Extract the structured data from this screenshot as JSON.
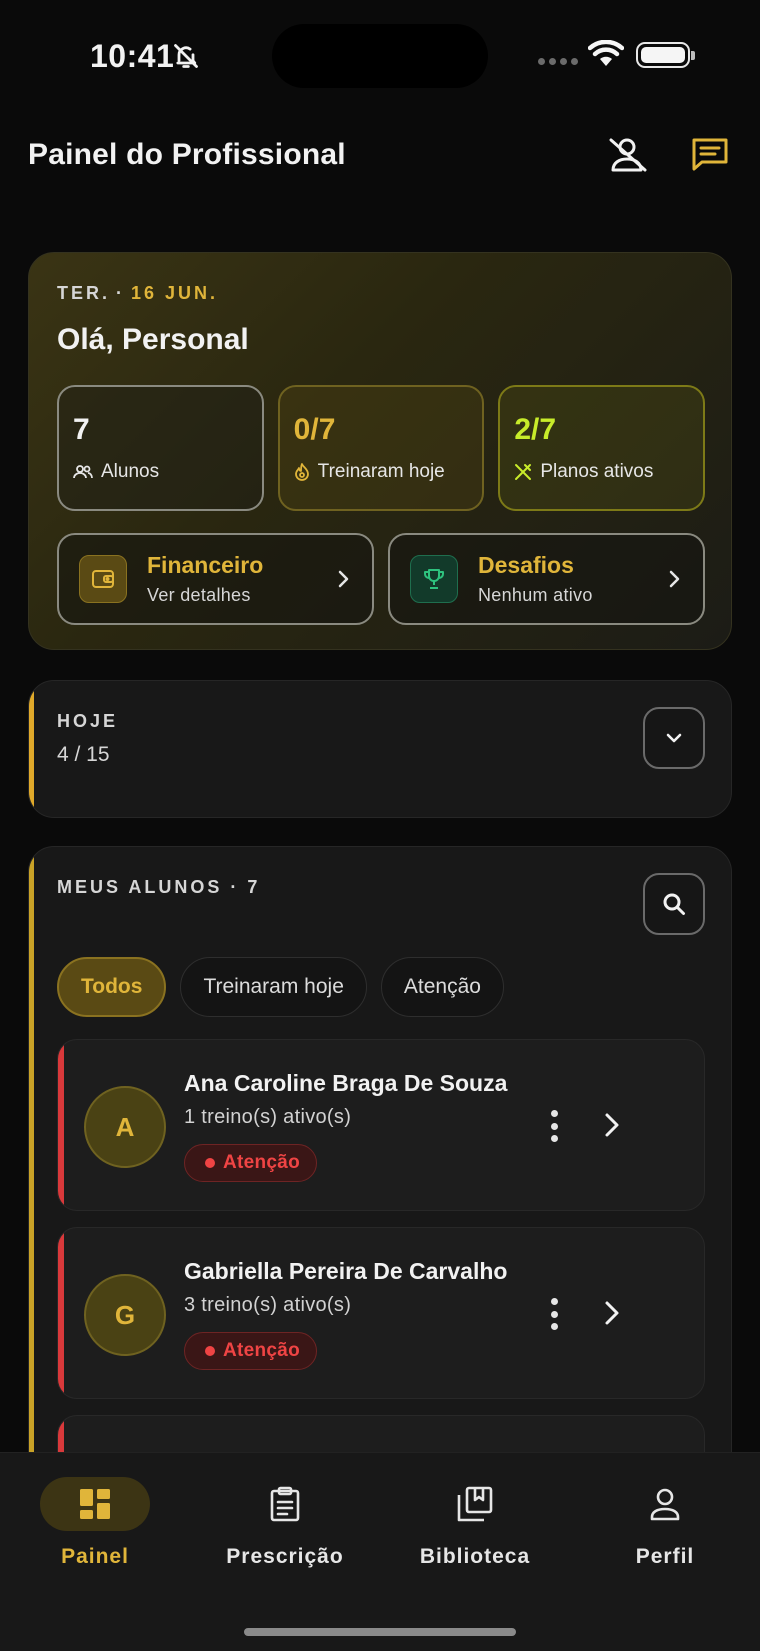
{
  "status_bar": {
    "time": "10:41"
  },
  "header": {
    "title": "Painel do Profissional"
  },
  "hero": {
    "weekday": "TER.",
    "separator": "·",
    "date": "16 JUN.",
    "greeting": "Olá, Personal",
    "stats": [
      {
        "value": "7",
        "label": "Alunos",
        "icon": "users-icon"
      },
      {
        "value": "0/7",
        "label": "Treinaram hoje",
        "icon": "flame-icon"
      },
      {
        "value": "2/7",
        "label": "Planos ativos",
        "icon": "utensils-icon"
      }
    ],
    "quick": [
      {
        "title": "Financeiro",
        "subtitle": "Ver detalhes",
        "icon": "wallet-icon"
      },
      {
        "title": "Desafios",
        "subtitle": "Nenhum ativo",
        "icon": "trophy-icon"
      }
    ]
  },
  "today": {
    "title": "HOJE",
    "count": "4 / 15"
  },
  "students": {
    "title": "MEUS ALUNOS · 7",
    "filters": [
      "Todos",
      "Treinaram hoje",
      "Atenção"
    ],
    "active_filter": "Todos",
    "items": [
      {
        "initial": "A",
        "name": "Ana Caroline Braga De Souza",
        "workouts": "1 treino(s) ativo(s)",
        "status": "Atenção"
      },
      {
        "initial": "G",
        "name": "Gabriella Pereira De Carvalho",
        "workouts": "3 treino(s) ativo(s)",
        "status": "Atenção"
      }
    ]
  },
  "nav": {
    "items": [
      {
        "label": "Painel",
        "icon": "dashboard-icon",
        "active": true
      },
      {
        "label": "Prescrição",
        "icon": "clipboard-icon",
        "active": false
      },
      {
        "label": "Biblioteca",
        "icon": "library-icon",
        "active": false
      },
      {
        "label": "Perfil",
        "icon": "person-icon",
        "active": false
      }
    ]
  },
  "colors": {
    "accent": "#e0b53a",
    "lime": "#c8ec2a",
    "danger": "#ef4444",
    "background": "#0a0a0a",
    "card": "#181818"
  }
}
